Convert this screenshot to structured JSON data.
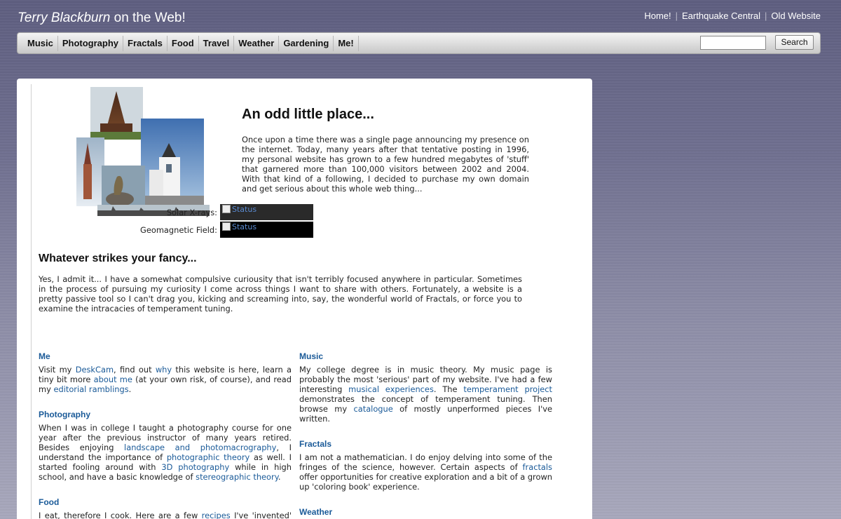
{
  "header": {
    "title_name": "Terry Blackburn",
    "title_rest": " on the Web!",
    "links": [
      "Home!",
      "Earthquake Central",
      "Old Website"
    ]
  },
  "nav": {
    "items": [
      "Music",
      "Photography",
      "Fractals",
      "Food",
      "Travel",
      "Weather",
      "Gardening",
      "Me!"
    ],
    "search_value": "",
    "search_button": "Search"
  },
  "intro": {
    "title": "An odd little place...",
    "text": "Once upon a time there was a single page announcing my presence on the internet. Today, many years after that tentative posting in 1996, my personal website has grown to a few hundred megabytes of 'stuff' that garnered more than 100,000 visitors between 2002 and 2004. With that kind of a following, I decided to purchase my own domain and get serious about this whole web thing..."
  },
  "status": {
    "xray_label": "Solar X-rays:",
    "xray_alt": "Status",
    "geo_label": "Geomagnetic Field:",
    "geo_alt": "Status"
  },
  "fancy": {
    "title": "Whatever strikes your fancy...",
    "text": "Yes, I admit it... I have a somewhat compulsive curiousity that isn't terribly focused anywhere in particular. Sometimes in the process of pursuing my curiosity I come across things I want to share with others. Fortunately, a website is a pretty passive tool so I can't drag you, kicking and screaming into, say, the wonderful world of Fractals, or force you to examine the intracacies of temperament tuning."
  },
  "sections": {
    "me": {
      "title": "Me",
      "t1": "Visit my ",
      "l1": "DeskCam",
      "t2": ", find out ",
      "l2": "why",
      "t3": " this website is here, learn a tiny bit more ",
      "l3": "about me",
      "t4": " (at your own risk, of course), and read my ",
      "l4": "editorial ramblings",
      "t5": "."
    },
    "photography": {
      "title": "Photography",
      "t1": "When I was in college I taught a photography course for one year after the previous instructor of many years retired. Besides enjoying ",
      "l1": "landscape and photomacrography",
      "t2": ", I understand the importance of ",
      "l2": "photographic theory",
      "t3": " as well. I started fooling around with ",
      "l3": "3D photography",
      "t4": " while in high school, and have a basic knowledge of ",
      "l4": "stereographic theory",
      "t5": "."
    },
    "food": {
      "title": "Food",
      "t1": "I eat, therefore I cook. Here are a few ",
      "l1": "recipes",
      "t2": " I've 'invented' myself!"
    },
    "music": {
      "title": "Music",
      "t1": "My college degree is in music theory. My music page is probably the most 'serious' part of my website. I've had a few interesting ",
      "l1": "musical experiences",
      "t2": ". The ",
      "l2": "temperament project",
      "t3": " demonstrates the concept of temperament tuning. Then browse my ",
      "l3": "catalogue",
      "t4": " of mostly unperformed pieces I've written."
    },
    "fractals": {
      "title": "Fractals",
      "t1": "I am not a mathematician. I do enjoy delving into some of the fringes of the science, however. Certain aspects of ",
      "l1": "fractals",
      "t2": " offer opportunities for creative exploration and a bit of a grown up 'coloring book' experience."
    },
    "weather": {
      "title": "Weather"
    }
  }
}
